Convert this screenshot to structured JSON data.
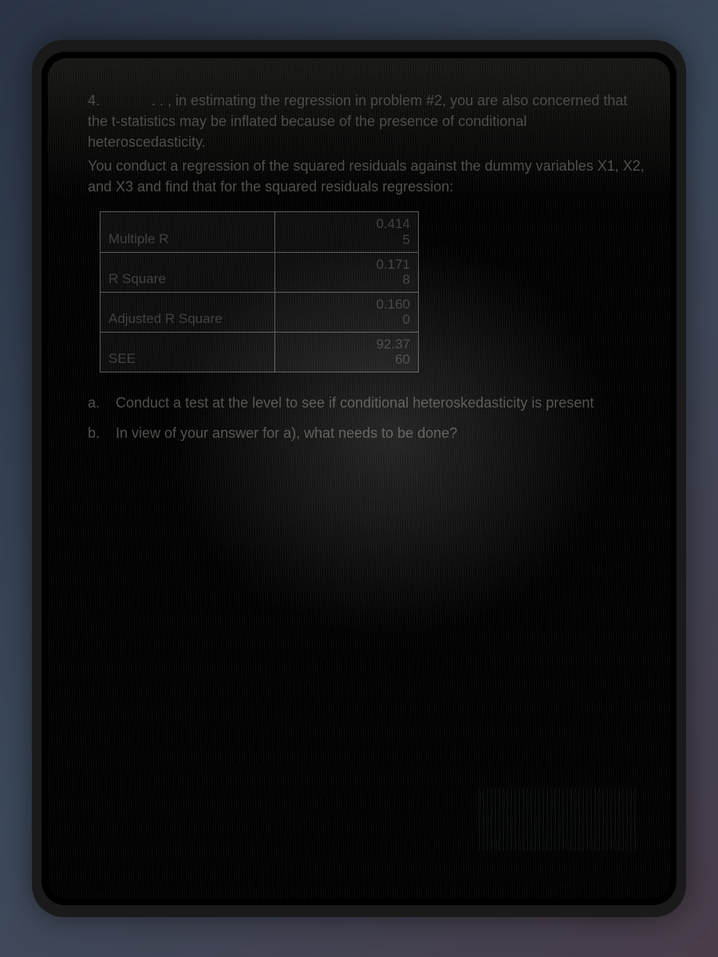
{
  "question": {
    "number": "4.",
    "intro1": ". . , in estimating the regression in problem #2, you are also concerned that the t-statistics may be inflated because of the presence of conditional heteroscedasticity.",
    "intro2": "You conduct a regression of the squared residuals against the dummy variables X1, X2, and X3 and find that for the squared residuals regression:"
  },
  "table": {
    "rows": [
      {
        "label": "Multiple R",
        "line1": "0.414",
        "line2": "5"
      },
      {
        "label": "R Square",
        "line1": "0.171",
        "line2": "8"
      },
      {
        "label": "Adjusted R Square",
        "line1": "0.160",
        "line2": "0"
      },
      {
        "label": "SEE",
        "line1": "92.37",
        "line2": "60"
      }
    ]
  },
  "subquestions": {
    "a": {
      "label": "a.",
      "text": "Conduct a test at the  level to see if conditional heteroskedasticity is present"
    },
    "b": {
      "label": "b.",
      "text": "In view of your answer for a), what needs to be done?"
    }
  }
}
